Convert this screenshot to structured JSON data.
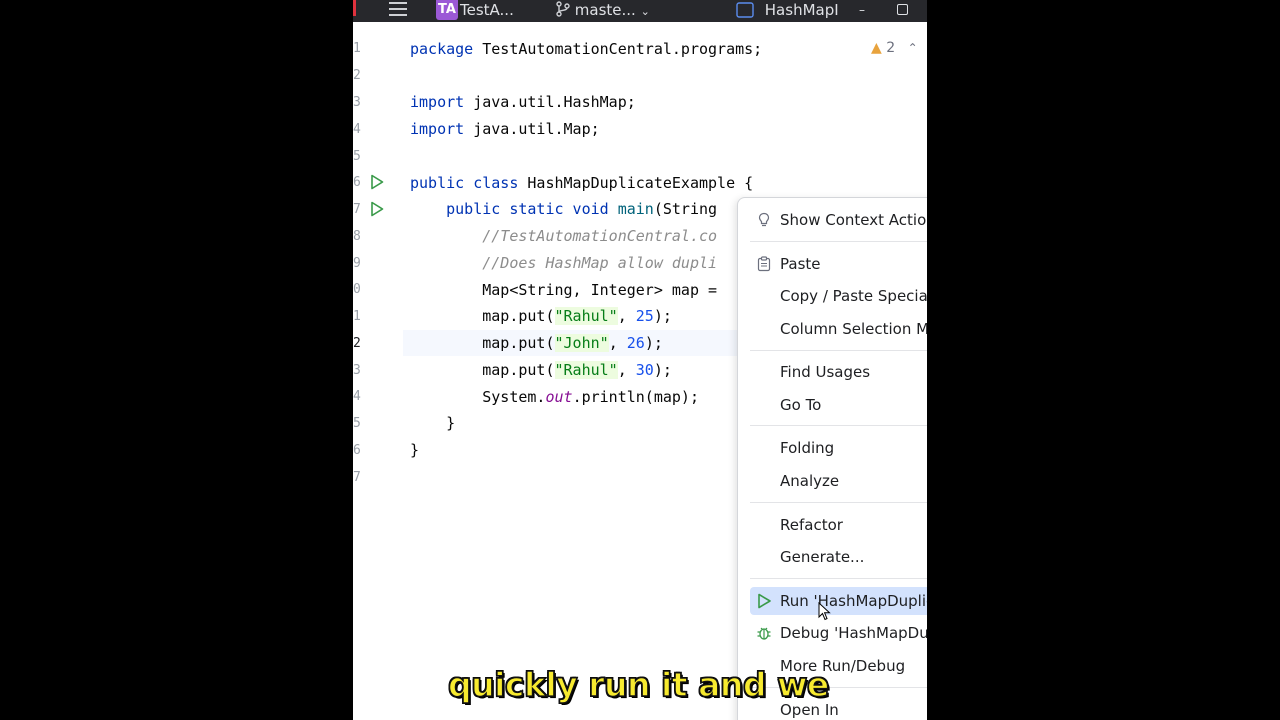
{
  "titlebar": {
    "project_badge": "TA",
    "project_name": "TestA...",
    "branch": "maste...",
    "file_tab": "HashMapI"
  },
  "editor": {
    "warning_count": "2",
    "line_numbers": [
      "1",
      "2",
      "3",
      "4",
      "5",
      "6",
      "7",
      "8",
      "9",
      "0",
      "1",
      "2",
      "3",
      "4",
      "5",
      "6",
      "7"
    ],
    "current_line_index": 11
  },
  "context_menu": {
    "items": [
      {
        "label": "Show Context Actio",
        "icon": "lightbulb-icon"
      },
      {
        "label": "Paste",
        "icon": "clipboard-icon"
      },
      {
        "label": "Copy / Paste Specia"
      },
      {
        "label": "Column Selection M"
      },
      {
        "label": "Find Usages"
      },
      {
        "label": "Go To"
      },
      {
        "label": "Folding"
      },
      {
        "label": "Analyze"
      },
      {
        "label": "Refactor"
      },
      {
        "label": "Generate..."
      },
      {
        "label": "Run 'HashMapDuplic",
        "icon": "run-triangle-icon",
        "selected": true
      },
      {
        "label": "Debug 'HashMapDu",
        "icon": "debug-bug-icon"
      },
      {
        "label": "More Run/Debug"
      },
      {
        "label": "Open In"
      }
    ]
  },
  "caption": "quickly run it and we",
  "colors": {
    "keyword": "#0033b3",
    "string": "#067d17",
    "number": "#1750eb",
    "comment": "#8c8c8c",
    "selection": "#d3e2fd",
    "caption": "#f7ea2f"
  }
}
